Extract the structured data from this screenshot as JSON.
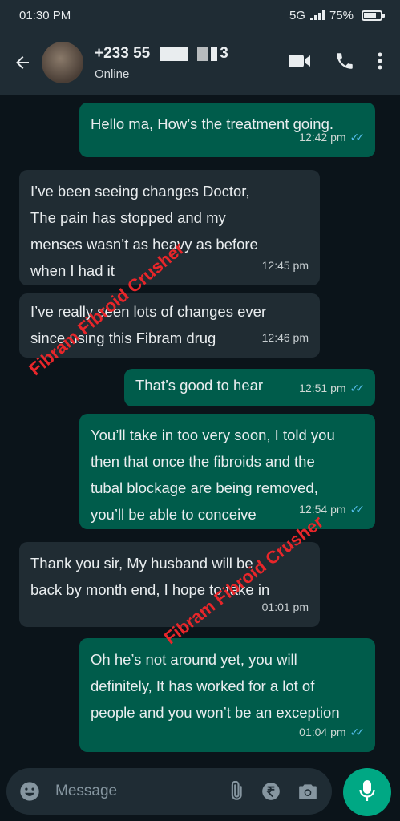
{
  "status_bar": {
    "time": "01:30 PM",
    "network": "5G",
    "battery": "75%",
    "battery_level": 0.75
  },
  "header": {
    "contact_prefix": "+233 5",
    "contact_mid": "5",
    "contact_suffix": "3",
    "presence": "Online"
  },
  "messages": [
    {
      "direction": "out",
      "text": "Hello ma, How’s the treatment going.",
      "time": "12:42 pm",
      "read": true
    },
    {
      "direction": "in",
      "lines": [
        "I’ve been seeing changes Doctor,",
        "The pain has stopped and my",
        "menses wasn’t as heavy as before",
        "when I had it"
      ],
      "time": "12:45 pm"
    },
    {
      "direction": "in",
      "lines": [
        "I’ve really seen lots of changes ever",
        "since using this Fibram drug"
      ],
      "time": "12:46 pm"
    },
    {
      "direction": "out",
      "text": "That’s good to hear",
      "time": "12:51 pm",
      "read": true
    },
    {
      "direction": "out",
      "lines": [
        "You’ll take in too very soon, I told you",
        "then that once the fibroids and the",
        "tubal blockage are being removed,",
        "you’ll be able to conceive"
      ],
      "time": "12:54 pm",
      "read": true
    },
    {
      "direction": "in",
      "lines": [
        "Thank you sir, My husband will be",
        "back by month end, I hope to take in"
      ],
      "time": "01:01 pm"
    },
    {
      "direction": "out",
      "lines": [
        "Oh he’s not around yet, you will",
        "definitely, It has worked for a lot of",
        "people and you won’t be an exception"
      ],
      "time": "01:04 pm",
      "read": true
    }
  ],
  "watermarks": [
    "Fibram Fibroid Crusher",
    "Fibram Fibroid Crusher"
  ],
  "composer": {
    "placeholder": "Message"
  },
  "icons": [
    "back-arrow-icon",
    "video-call-icon",
    "voice-call-icon",
    "more-options-icon",
    "emoji-icon",
    "attach-icon",
    "rupee-payment-icon",
    "camera-icon",
    "mic-icon"
  ],
  "colors": {
    "outgoing_bubble": "#005c4b",
    "incoming_bubble": "#202c33",
    "accent": "#00a884",
    "read_ticks": "#53bdeb",
    "watermark": "#e8262a"
  }
}
